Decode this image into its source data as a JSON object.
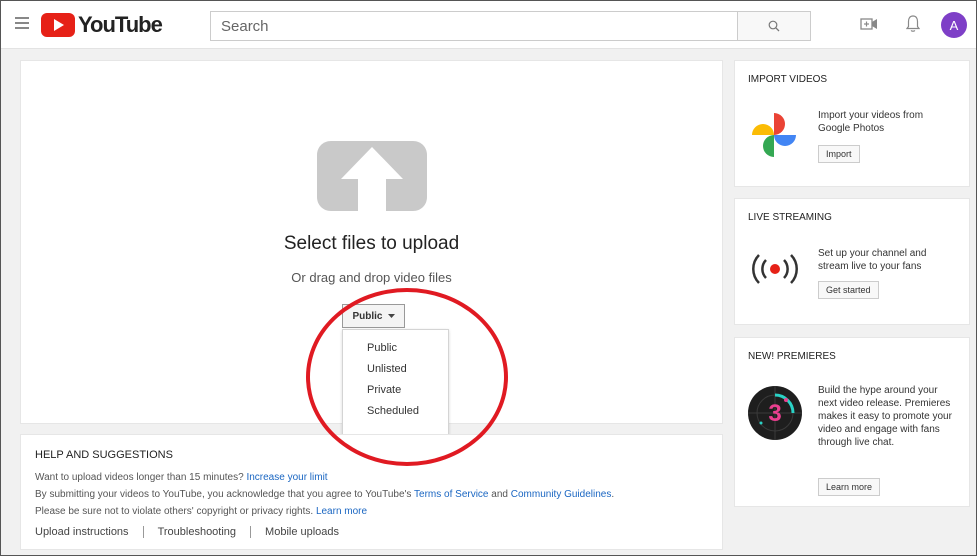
{
  "header": {
    "logo_text": "YouTube",
    "search_placeholder": "Search",
    "avatar_letter": "A"
  },
  "upload": {
    "title": "Select files to upload",
    "subtitle": "Or drag and drop video files",
    "privacy_selected": "Public",
    "privacy_options": [
      "Public",
      "Unlisted",
      "Private",
      "Scheduled"
    ]
  },
  "help": {
    "title": "HELP AND SUGGESTIONS",
    "line1_text": "Want to upload videos longer than 15 minutes? ",
    "line1_link": "Increase your limit",
    "line2_text_a": "By submitting your videos to YouTube, you acknowledge that you agree to YouTube's ",
    "line2_link_a": "Terms of Service",
    "line2_text_b": " and ",
    "line2_link_b": "Community Guidelines",
    "line2_text_c": ".",
    "line3_text": "Please be sure not to violate others' copyright or privacy rights. ",
    "line3_link": "Learn more",
    "links": [
      "Upload instructions",
      "Troubleshooting",
      "Mobile uploads"
    ]
  },
  "sidebar": {
    "import": {
      "title": "IMPORT VIDEOS",
      "text": "Import your videos from Google Photos",
      "button": "Import"
    },
    "live": {
      "title": "LIVE STREAMING",
      "text": "Set up your channel and stream live to your fans",
      "button": "Get started"
    },
    "premieres": {
      "title": "NEW! PREMIERES",
      "text": "Build the hype around your next video release. Premieres makes it easy to promote your video and engage with fans through live chat.",
      "button": "Learn more",
      "badge_number": "3"
    }
  },
  "colors": {
    "brand_red": "#e62117",
    "link_blue": "#1a66c2",
    "avatar_purple": "#7e3fc7",
    "annotation_red": "#e01a22"
  }
}
